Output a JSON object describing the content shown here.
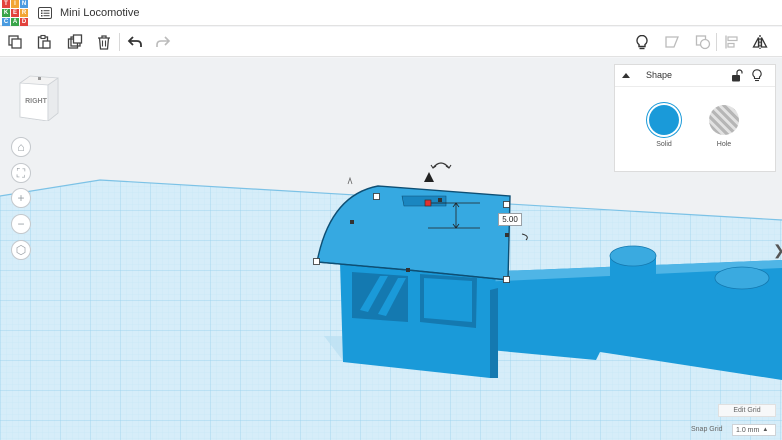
{
  "app": {
    "logo_letters": [
      "T",
      "I",
      "N",
      "K",
      "E",
      "R",
      "C",
      "A",
      "D"
    ],
    "project_title": "Mini Locomotive"
  },
  "toolbar": {
    "left": [
      "copy-icon",
      "paste-icon",
      "duplicate-icon",
      "delete-icon",
      "undo-icon",
      "redo-icon"
    ],
    "right": [
      "lightbulb-icon",
      "note-icon",
      "group-icon",
      "align-icon",
      "mirror-icon"
    ]
  },
  "viewcube": {
    "face_label": "RIGHT"
  },
  "nav": {
    "home": "⌂",
    "fit": "⛶",
    "zoom_in": "+",
    "zoom_out": "−",
    "ortho": "⬡"
  },
  "shape_panel": {
    "title": "Shape",
    "solid_label": "Solid",
    "hole_label": "Hole",
    "solid_color": "#1a9ad9"
  },
  "dimension": {
    "value": "5.00"
  },
  "grid": {
    "edit_label": "Edit Grid",
    "snap_label": "Snap Grid",
    "snap_value": "1.0 mm"
  },
  "colors": {
    "shape": "#1a9ad9",
    "shape_dark": "#1479b0",
    "grid_line": "#a9d8ef",
    "workplane": "#d6edf9"
  }
}
